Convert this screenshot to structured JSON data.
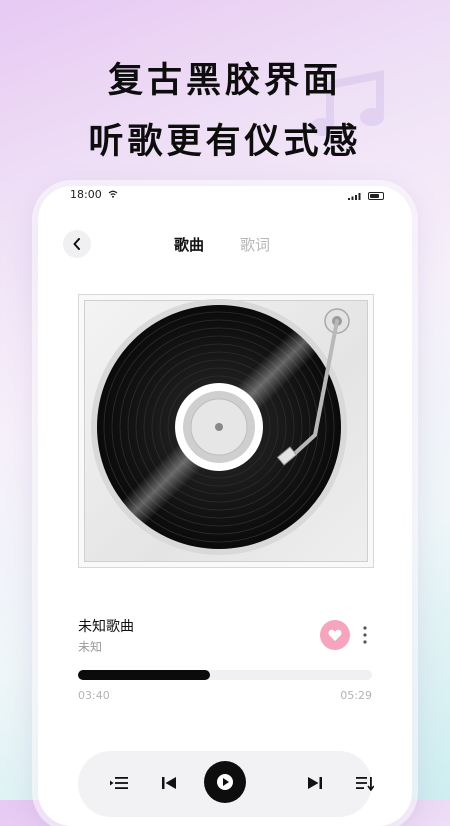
{
  "promo": {
    "line1": "复古黑胶界面",
    "line2": "听歌更有仪式感"
  },
  "status_bar": {
    "time": "18:00"
  },
  "tabs": [
    {
      "label": "歌曲",
      "active": true
    },
    {
      "label": "歌词",
      "active": false
    }
  ],
  "song": {
    "title": "未知歌曲",
    "artist": "未知",
    "liked": true
  },
  "playback": {
    "current_time": "03:40",
    "total_time": "05:29",
    "progress": 0.45
  },
  "icons": {
    "back": "chevron-left-icon",
    "like": "heart-icon",
    "more": "more-vertical-icon",
    "playlist": "playlist-icon",
    "previous": "skip-previous-icon",
    "play": "play-icon",
    "next": "skip-next-icon",
    "queue": "queue-sort-icon"
  },
  "colors": {
    "accent_pink": "#f6a5be",
    "progress": "#0b0b0b",
    "inactive_text": "#b5b5b8"
  }
}
